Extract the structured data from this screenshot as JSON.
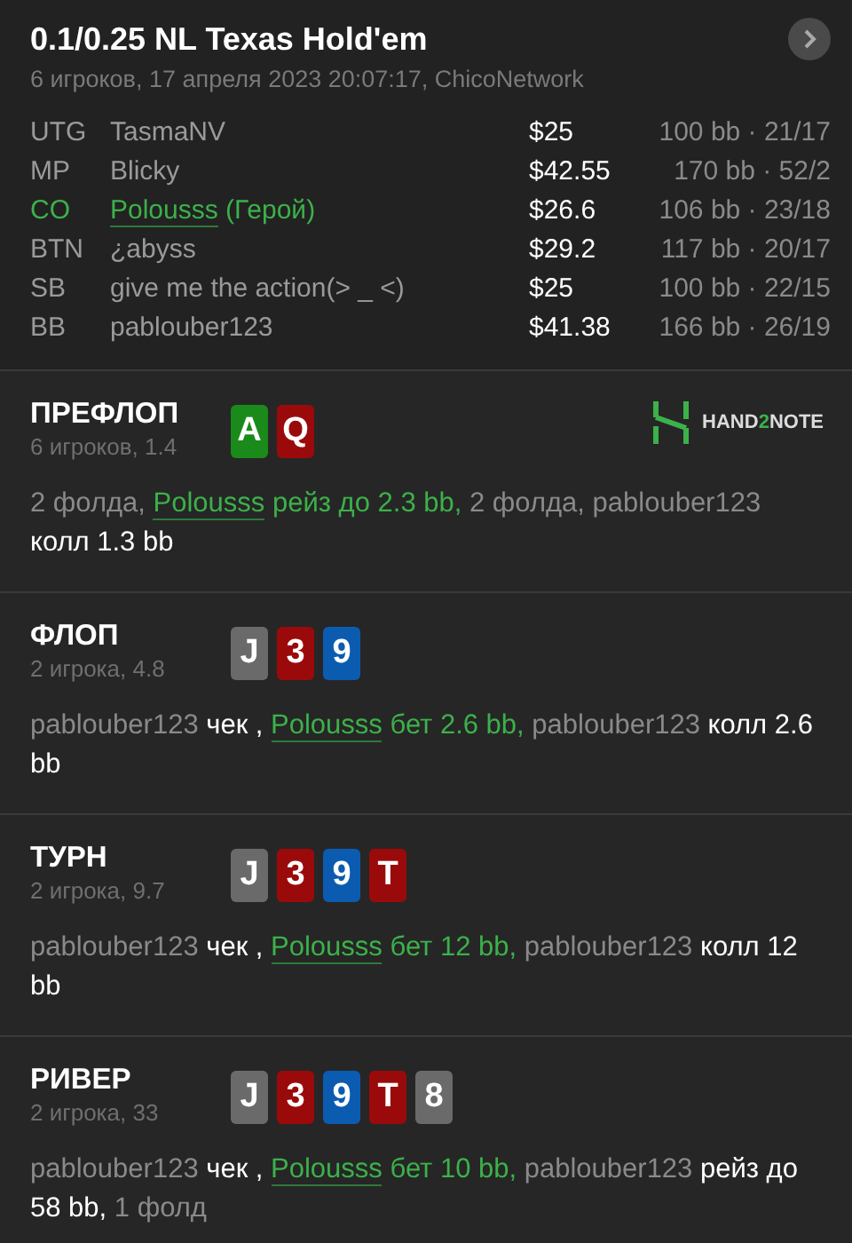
{
  "header": {
    "title": "0.1/0.25 NL Texas Hold'em",
    "subtitle": "6 игроков, 17 апреля 2023 20:07:17, ChicoNetwork"
  },
  "players": [
    {
      "position": "UTG",
      "name": "TasmaNV",
      "hero": false,
      "stack": "$25",
      "bb_stats": "100 bb · 21/17"
    },
    {
      "position": "MP",
      "name": "Blicky",
      "hero": false,
      "stack": "$42.55",
      "bb_stats": "170 bb · 52/2"
    },
    {
      "position": "CO",
      "name": "Polousss",
      "hero": true,
      "note": "(Герой)",
      "stack": "$26.6",
      "bb_stats": "106 bb · 23/18"
    },
    {
      "position": "BTN",
      "name": "¿abyss",
      "hero": false,
      "stack": "$29.2",
      "bb_stats": "117 bb · 20/17"
    },
    {
      "position": "SB",
      "name": "give me the action(> _ <)",
      "hero": false,
      "stack": "$25",
      "bb_stats": "100 bb · 22/15"
    },
    {
      "position": "BB",
      "name": "pablouber123",
      "hero": false,
      "stack": "$41.38",
      "bb_stats": "166 bb · 26/19"
    }
  ],
  "logo": {
    "parts": [
      {
        "text": "HAND",
        "kind": "plain"
      },
      {
        "text": "2",
        "kind": "accent"
      },
      {
        "text": "NOTE",
        "kind": "plain"
      }
    ]
  },
  "streets": [
    {
      "title": "ПРЕФЛОП",
      "info": "6 игроков, 1.4",
      "logo": true,
      "cards": [
        {
          "rank": "A",
          "color": "#1a8a1a"
        },
        {
          "rank": "Q",
          "color": "#9b0a0a"
        }
      ],
      "actions": [
        {
          "kind": "plain",
          "text": "2 фолда, "
        },
        {
          "kind": "hero_name",
          "text": "Polousss"
        },
        {
          "kind": "hero",
          "text": " рейз до 2.3 bb,"
        },
        {
          "kind": "plain",
          "text": " 2 фолда, pablouber123 "
        },
        {
          "kind": "action",
          "text": "колл 1.3 bb"
        }
      ]
    },
    {
      "title": "ФЛОП",
      "info": "2 игрока, 4.8",
      "logo": false,
      "cards": [
        {
          "rank": "J",
          "color": "#6a6a6a"
        },
        {
          "rank": "3",
          "color": "#9b0a0a"
        },
        {
          "rank": "9",
          "color": "#0b5cb0"
        }
      ],
      "actions": [
        {
          "kind": "plain",
          "text": "pablouber123 "
        },
        {
          "kind": "action",
          "text": "чек , "
        },
        {
          "kind": "hero_name",
          "text": "Polousss"
        },
        {
          "kind": "hero",
          "text": " бет 2.6 bb,"
        },
        {
          "kind": "plain",
          "text": " pablouber123 "
        },
        {
          "kind": "action",
          "text": "колл 2.6 bb"
        }
      ]
    },
    {
      "title": "ТУРН",
      "info": "2 игрока, 9.7",
      "logo": false,
      "cards": [
        {
          "rank": "J",
          "color": "#6a6a6a"
        },
        {
          "rank": "3",
          "color": "#9b0a0a"
        },
        {
          "rank": "9",
          "color": "#0b5cb0"
        },
        {
          "rank": "T",
          "color": "#9b0a0a"
        }
      ],
      "actions": [
        {
          "kind": "plain",
          "text": "pablouber123 "
        },
        {
          "kind": "action",
          "text": "чек , "
        },
        {
          "kind": "hero_name",
          "text": "Polousss"
        },
        {
          "kind": "hero",
          "text": " бет 12 bb,"
        },
        {
          "kind": "plain",
          "text": " pablouber123 "
        },
        {
          "kind": "action",
          "text": "колл 12 bb"
        }
      ]
    },
    {
      "title": "РИВЕР",
      "info": "2 игрока, 33",
      "logo": false,
      "cards": [
        {
          "rank": "J",
          "color": "#6a6a6a"
        },
        {
          "rank": "3",
          "color": "#9b0a0a"
        },
        {
          "rank": "9",
          "color": "#0b5cb0"
        },
        {
          "rank": "T",
          "color": "#9b0a0a"
        },
        {
          "rank": "8",
          "color": "#6a6a6a"
        }
      ],
      "actions": [
        {
          "kind": "plain",
          "text": "pablouber123 "
        },
        {
          "kind": "action",
          "text": "чек , "
        },
        {
          "kind": "hero_name",
          "text": "Polousss"
        },
        {
          "kind": "hero",
          "text": " бет 10 bb,"
        },
        {
          "kind": "plain",
          "text": " pablouber123 "
        },
        {
          "kind": "action",
          "text": "рейз до 58 bb,"
        },
        {
          "kind": "plain",
          "text": " 1 фолд"
        }
      ]
    }
  ]
}
